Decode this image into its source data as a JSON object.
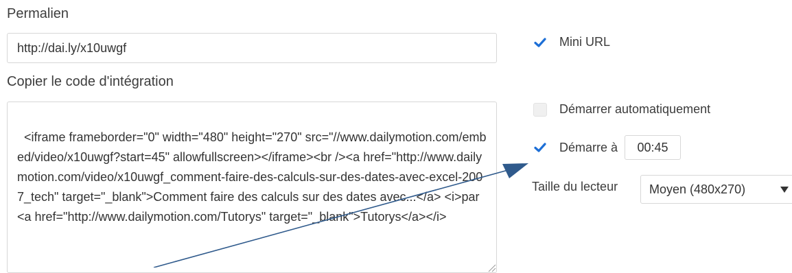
{
  "permalink": {
    "label": "Permalien",
    "value": "http://dai.ly/x10uwgf"
  },
  "embed": {
    "label": "Copier le code d'intégration",
    "code": "<iframe frameborder=\"0\" width=\"480\" height=\"270\" src=\"//www.dailymotion.com/embed/video/x10uwgf?start=45\" allowfullscreen></iframe><br /><a href=\"http://www.dailymotion.com/video/x10uwgf_comment-faire-des-calculs-sur-des-dates-avec-excel-2007_tech\" target=\"_blank\">Comment faire des calculs sur des dates avec...</a> <i>par <a href=\"http://www.dailymotion.com/Tutorys\" target=\"_blank\">Tutorys</a></i>"
  },
  "options": {
    "mini_url": {
      "label": "Mini URL",
      "checked": true
    },
    "autoplay": {
      "label": "Démarrer automatiquement",
      "checked": false
    },
    "start_at": {
      "label": "Démarre à",
      "checked": true,
      "time": "00:45"
    },
    "player_size": {
      "label": "Taille du lecteur",
      "selected": "Moyen (480x270)"
    }
  },
  "colors": {
    "check_blue": "#1d6fd6",
    "arrow_blue": "#2f5a8c",
    "border": "#d7d7d7"
  }
}
